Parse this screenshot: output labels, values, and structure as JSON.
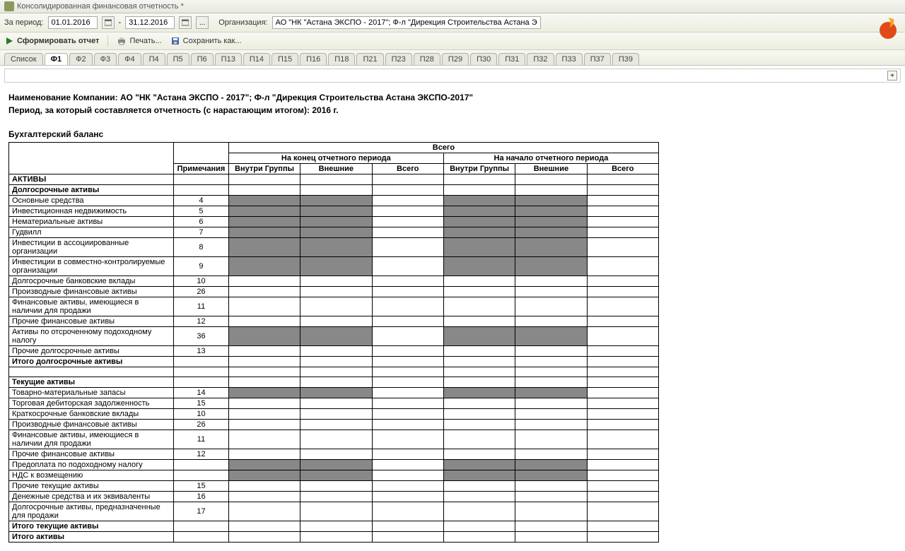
{
  "window": {
    "title": "Консолидированная финансовая отчетность *"
  },
  "filter": {
    "period_label": "За период:",
    "date_from": "01.01.2016",
    "date_to": "31.12.2016",
    "dash": "-",
    "dots": "...",
    "org_label": "Организация:",
    "org_value": "АО \"НК \"Астана ЭКСПО - 2017\"; Ф-л \"Дирекция Строительства Астана ЭКСПО-2017\""
  },
  "actions": {
    "run": "Сформировать отчет",
    "print": "Печать...",
    "save_as": "Сохранить как..."
  },
  "tabs": [
    "Список",
    "Ф1",
    "Ф2",
    "Ф3",
    "Ф4",
    "П4",
    "П5",
    "П6",
    "П13",
    "П14",
    "П15",
    "П16",
    "П18",
    "П21",
    "П23",
    "П28",
    "П29",
    "П30",
    "П31",
    "П32",
    "П33",
    "П37",
    "П39"
  ],
  "active_tab": "Ф1",
  "expand_icon": "+",
  "report_header": {
    "line1_label": "Наименование Компании:",
    "line1_value": "АО \"НК \"Астана ЭКСПО - 2017\"; Ф-л \"Дирекция Строительства Астана ЭКСПО-2017\"",
    "line2_label": "Период, за который составляется отчетность (с нарастающим итогом):",
    "line2_value": "2016 г."
  },
  "section_title": "Бухгалтерский баланс",
  "thead": {
    "total": "Всего",
    "notes": "Примечания",
    "end_period": "На конец отчетного периода",
    "start_period": "На начало отчетного периода",
    "in_group": "Внутри Группы",
    "external": "Внешние",
    "sum": "Всего"
  },
  "rows": [
    {
      "label": "АКТИВЫ",
      "note": "",
      "bold": true,
      "shaded": false
    },
    {
      "label": "Долгосрочные активы",
      "note": "",
      "bold": true,
      "shaded": false
    },
    {
      "label": "Основные средства",
      "note": "4",
      "bold": false,
      "shaded": true
    },
    {
      "label": "Инвестиционная недвижимость",
      "note": "5",
      "bold": false,
      "shaded": true
    },
    {
      "label": "Нематериальные активы",
      "note": "6",
      "bold": false,
      "shaded": true
    },
    {
      "label": "Гудвилл",
      "note": "7",
      "bold": false,
      "shaded": true
    },
    {
      "label": "Инвестиции в ассоциированные организации",
      "note": "8",
      "bold": false,
      "shaded": true
    },
    {
      "label": "Инвестиции в совместно-контролируемые организации",
      "note": "9",
      "bold": false,
      "shaded": true
    },
    {
      "label": "Долгосрочные банковские вклады",
      "note": "10",
      "bold": false,
      "shaded": false
    },
    {
      "label": "Производные финансовые активы",
      "note": "26",
      "bold": false,
      "shaded": false
    },
    {
      "label": "Финансовые активы, имеющиеся в наличии для продажи",
      "note": "11",
      "bold": false,
      "shaded": false
    },
    {
      "label": "Прочие финансовые активы",
      "note": "12",
      "bold": false,
      "shaded": false
    },
    {
      "label": "Активы по отсроченному подоходному налогу",
      "note": "36",
      "bold": false,
      "shaded": true
    },
    {
      "label": "Прочие долгосрочные активы",
      "note": "13",
      "bold": false,
      "shaded": false
    },
    {
      "label": "Итого долгосрочные активы",
      "note": "",
      "bold": true,
      "shaded": false
    },
    {
      "label": "",
      "note": "",
      "bold": false,
      "shaded": false
    },
    {
      "label": "Текущие активы",
      "note": "",
      "bold": true,
      "shaded": false
    },
    {
      "label": "Товарно-материальные запасы",
      "note": "14",
      "bold": false,
      "shaded": true
    },
    {
      "label": "Торговая дебиторская задолженность",
      "note": "15",
      "bold": false,
      "shaded": false
    },
    {
      "label": "Краткосрочные банковские вклады",
      "note": "10",
      "bold": false,
      "shaded": false
    },
    {
      "label": "Производные финансовые активы",
      "note": "26",
      "bold": false,
      "shaded": false
    },
    {
      "label": "Финансовые активы, имеющиеся в наличии для продажи",
      "note": "11",
      "bold": false,
      "shaded": false
    },
    {
      "label": "Прочие финансовые активы",
      "note": "12",
      "bold": false,
      "shaded": false
    },
    {
      "label": "Предоплата по подоходному налогу",
      "note": "",
      "bold": false,
      "shaded": true
    },
    {
      "label": "НДС к возмещению",
      "note": "",
      "bold": false,
      "shaded": true
    },
    {
      "label": "Прочие текущие активы",
      "note": "15",
      "bold": false,
      "shaded": false
    },
    {
      "label": "Денежные средства и их эквиваленты",
      "note": "16",
      "bold": false,
      "shaded": false
    },
    {
      "label": "Долгосрочные активы, предназначенные для продажи",
      "note": "17",
      "bold": false,
      "shaded": false
    },
    {
      "label": "Итого текущие активы",
      "note": "",
      "bold": true,
      "shaded": false
    },
    {
      "label": "Итого активы",
      "note": "",
      "bold": true,
      "shaded": false
    }
  ]
}
